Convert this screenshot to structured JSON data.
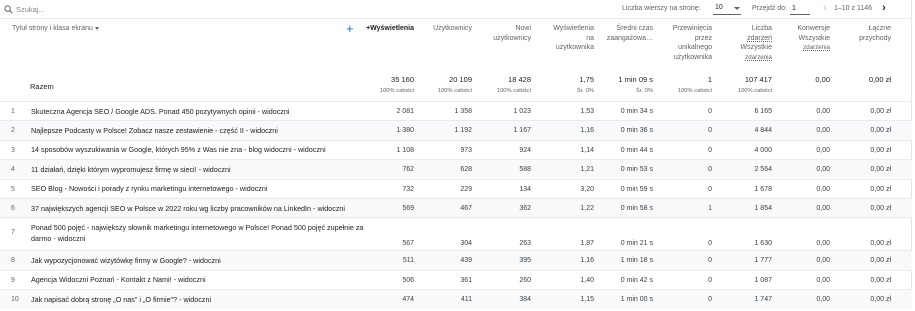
{
  "toolbar": {
    "search_placeholder": "Szukaj...",
    "rows_per_page_label": "Liczba wierszy na stronę:",
    "rows_per_page_value": "10",
    "goto_label": "Przejdź do:",
    "goto_value": "1",
    "pagination_text": "1–10 z 1146"
  },
  "header": {
    "dimension": "Tytuł strony i klasa ekranu",
    "col_views": "Wyświetlenia",
    "col_users": "Użytkownicy",
    "col_new_users_1": "Nowi",
    "col_new_users_2": "użytkownicy",
    "col_views_per_user_1": "Wyświetlenia",
    "col_views_per_user_2": "na",
    "col_views_per_user_3": "użytkownika",
    "col_avg_time_1": "Średni czas",
    "col_avg_time_2": "zaangażowa…",
    "col_scrolled_1": "Przewinięcia",
    "col_scrolled_2": "przez",
    "col_scrolled_3": "unikalnego",
    "col_scrolled_4": "użytkownika",
    "col_events_1": "Liczba",
    "col_events_2": "zdarzeń",
    "col_events_3": "Wszystkie",
    "col_events_4": "zdarzenia",
    "col_conv_1": "Konwersje",
    "col_conv_2": "Wszystkie",
    "col_conv_3": "zdarzenia",
    "col_revenue_1": "Łączne",
    "col_revenue_2": "przychody"
  },
  "totals": {
    "label": "Razem",
    "views": "35 160",
    "views_sub": "100% całości",
    "users": "20 109",
    "users_sub": "100% całości",
    "new_users": "18 428",
    "new_users_sub": "100% całości",
    "views_per_user": "1,75",
    "views_per_user_sub": "Śr. 0%",
    "avg_time": "1 min 09 s",
    "avg_time_sub": "Śr. 0%",
    "scrolled": "1",
    "scrolled_sub": "100% całości",
    "events": "107 417",
    "events_sub": "100% całości",
    "conversions": "0,00",
    "revenue": "0,00 zł"
  },
  "rows": [
    {
      "idx": "1",
      "page": "Skuteczna Agencja SEO / Google ADS. Ponad 450 pozytywnych opinii - widoczni",
      "views": "2 081",
      "users": "1 358",
      "new_users": "1 023",
      "vpu": "1,53",
      "time": "0 min 34 s",
      "scrolled": "0",
      "events": "6 165",
      "conv": "0,00",
      "rev": "0,00 zł"
    },
    {
      "idx": "2",
      "page": "Najlepsze Podcasty w Polsce! Zobacz nasze zestawienie - część II - widoczni",
      "views": "1 380",
      "users": "1 192",
      "new_users": "1 167",
      "vpu": "1,16",
      "time": "0 min 36 s",
      "scrolled": "0",
      "events": "4 844",
      "conv": "0,00",
      "rev": "0,00 zł"
    },
    {
      "idx": "3",
      "page": "14 sposobów wyszukiwania w Google, których 95% z Was nie zna - blog widoczni - widoczni",
      "views": "1 108",
      "users": "973",
      "new_users": "924",
      "vpu": "1,14",
      "time": "0 min 44 s",
      "scrolled": "0",
      "events": "4 000",
      "conv": "0,00",
      "rev": "0,00 zł"
    },
    {
      "idx": "4",
      "page": "11 działań, dzięki którym wypromujesz firmę w sieci! - widoczni",
      "views": "762",
      "users": "628",
      "new_users": "588",
      "vpu": "1,21",
      "time": "0 min 53 s",
      "scrolled": "0",
      "events": "2 564",
      "conv": "0,00",
      "rev": "0,00 zł"
    },
    {
      "idx": "5",
      "page": "SEO Blog - Nowości i porady z rynku marketingu internetowego - widoczni",
      "views": "732",
      "users": "229",
      "new_users": "134",
      "vpu": "3,20",
      "time": "0 min 59 s",
      "scrolled": "0",
      "events": "1 678",
      "conv": "0,00",
      "rev": "0,00 zł"
    },
    {
      "idx": "6",
      "page": "37 największych agencji SEO w Polsce w 2022 roku wg liczby pracowników na LinkedIn - widoczni",
      "views": "569",
      "users": "467",
      "new_users": "362",
      "vpu": "1,22",
      "time": "0 min 58 s",
      "scrolled": "1",
      "events": "1 854",
      "conv": "0,00",
      "rev": "0,00 zł"
    },
    {
      "idx": "7",
      "page": "Ponad 500 pojęć - największy słownik marketingu internetowego w Polsce! Ponad 500 pojęć zupełnie za darmo - widoczni",
      "views": "567",
      "users": "304",
      "new_users": "263",
      "vpu": "1,87",
      "time": "0 min 21 s",
      "scrolled": "0",
      "events": "1 630",
      "conv": "0,00",
      "rev": "0,00 zł"
    },
    {
      "idx": "8",
      "page": "Jak wypozycjonować wizytówkę firmy w Google? - widoczni",
      "views": "511",
      "users": "439",
      "new_users": "395",
      "vpu": "1,16",
      "time": "1 min 18 s",
      "scrolled": "0",
      "events": "1 777",
      "conv": "0,00",
      "rev": "0,00 zł"
    },
    {
      "idx": "9",
      "page": "Agencja Widoczni Poznań - Kontakt z Nami! - widoczni",
      "views": "506",
      "users": "361",
      "new_users": "260",
      "vpu": "1,40",
      "time": "0 min 42 s",
      "scrolled": "0",
      "events": "1 087",
      "conv": "0,00",
      "rev": "0,00 zł"
    },
    {
      "idx": "10",
      "page": "Jak napisać dobrą stronę „O nas\" i „O firmie\"? - widoczni",
      "views": "474",
      "users": "411",
      "new_users": "384",
      "vpu": "1,15",
      "time": "1 min 00 s",
      "scrolled": "0",
      "events": "1 747",
      "conv": "0,00",
      "rev": "0,00 zł"
    }
  ],
  "colors": {
    "accent": "#1a73e8",
    "text": "#202124",
    "muted": "#5f6368",
    "row_shade": "#f8f9fa"
  }
}
